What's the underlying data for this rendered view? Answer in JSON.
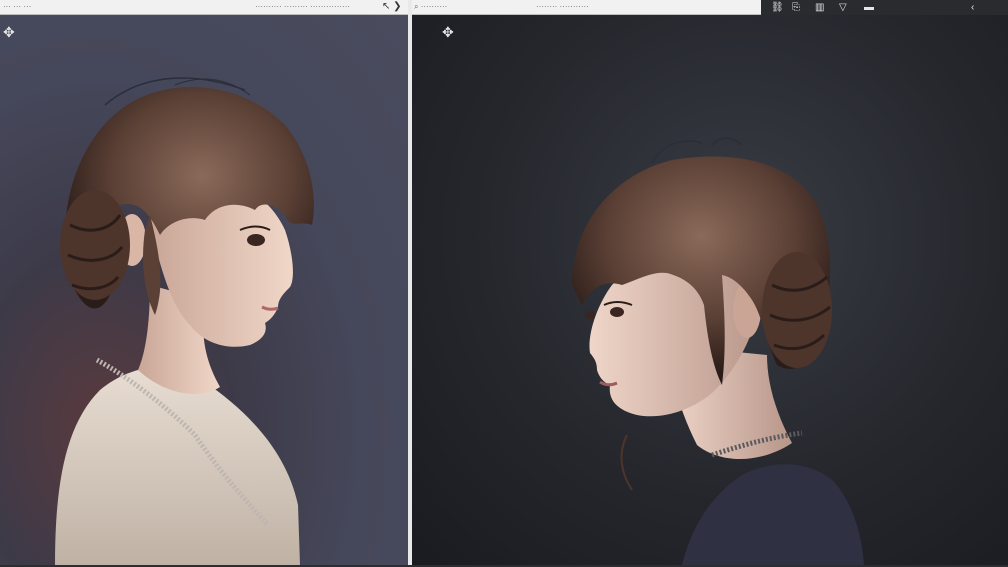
{
  "left_window": {
    "title_left": "··· ··· ···",
    "title_right": "·········· ········· ···············",
    "corner_glyph": "↖ ❯"
  },
  "right_window": {
    "title_left": "⌕ ··········",
    "title_center": "········ ···········"
  },
  "toolbar": {
    "items": [
      "⛓",
      "⎘",
      "▥",
      "▽",
      "▬",
      "‹"
    ]
  },
  "icons": {
    "left_panel_compass": "compass-icon",
    "right_panel_compass": "compass-icon"
  },
  "colors": {
    "left_bg": "#4a4c5e",
    "right_bg": "#1a1b20",
    "hair": "#5b4035",
    "skin": "#e8c9b8",
    "sweater_left": "#ddd2c5",
    "shirt_right": "#2f3142"
  }
}
